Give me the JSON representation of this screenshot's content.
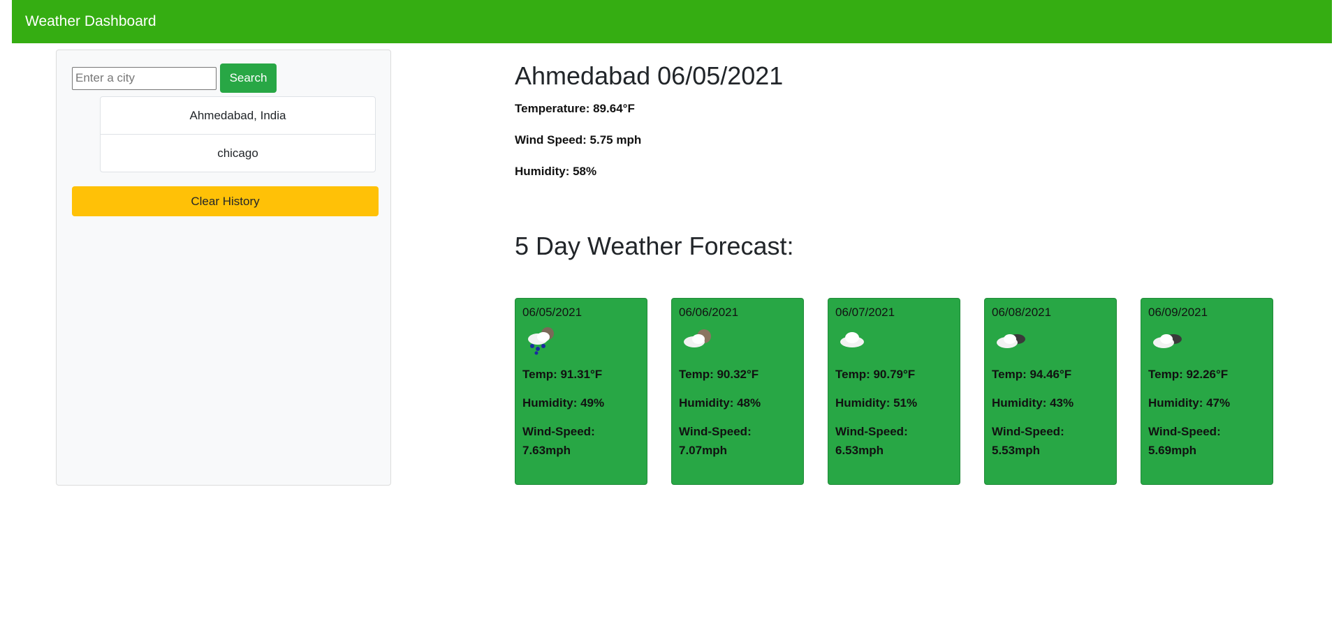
{
  "navbar": {
    "brand": "Weather Dashboard"
  },
  "sidebar": {
    "search": {
      "placeholder": "Enter a city",
      "value": "",
      "button_label": "Search"
    },
    "history": [
      "Ahmedabad, India",
      "chicago"
    ],
    "clear_label": "Clear History"
  },
  "current": {
    "title": "Ahmedabad 06/05/2021",
    "temperature": "Temperature: 89.64°F",
    "wind": "Wind Speed: 5.75 mph",
    "humidity": "Humidity: 58%"
  },
  "forecast": {
    "title": "5 Day Weather Forecast:",
    "days": [
      {
        "date": "06/05/2021",
        "icon": "rain-cloud-icon",
        "temp": "Temp: 91.31°F",
        "humidity": "Humidity: 49%",
        "wind_label": "Wind-Speed:",
        "wind_value": "7.63mph"
      },
      {
        "date": "06/06/2021",
        "icon": "partly-cloudy-icon",
        "temp": "Temp: 90.32°F",
        "humidity": "Humidity: 48%",
        "wind_label": "Wind-Speed:",
        "wind_value": "7.07mph"
      },
      {
        "date": "06/07/2021",
        "icon": "cloud-icon",
        "temp": "Temp: 90.79°F",
        "humidity": "Humidity: 51%",
        "wind_label": "Wind-Speed:",
        "wind_value": "6.53mph"
      },
      {
        "date": "06/08/2021",
        "icon": "broken-clouds-icon",
        "temp": "Temp: 94.46°F",
        "humidity": "Humidity: 43%",
        "wind_label": "Wind-Speed:",
        "wind_value": "5.53mph"
      },
      {
        "date": "06/09/2021",
        "icon": "broken-clouds-icon",
        "temp": "Temp: 92.26°F",
        "humidity": "Humidity: 47%",
        "wind_label": "Wind-Speed:",
        "wind_value": "5.69mph"
      }
    ]
  },
  "colors": {
    "navbar": "#35ad12",
    "card": "#28a745",
    "clear": "#ffc107",
    "search_button": "#28a745"
  }
}
